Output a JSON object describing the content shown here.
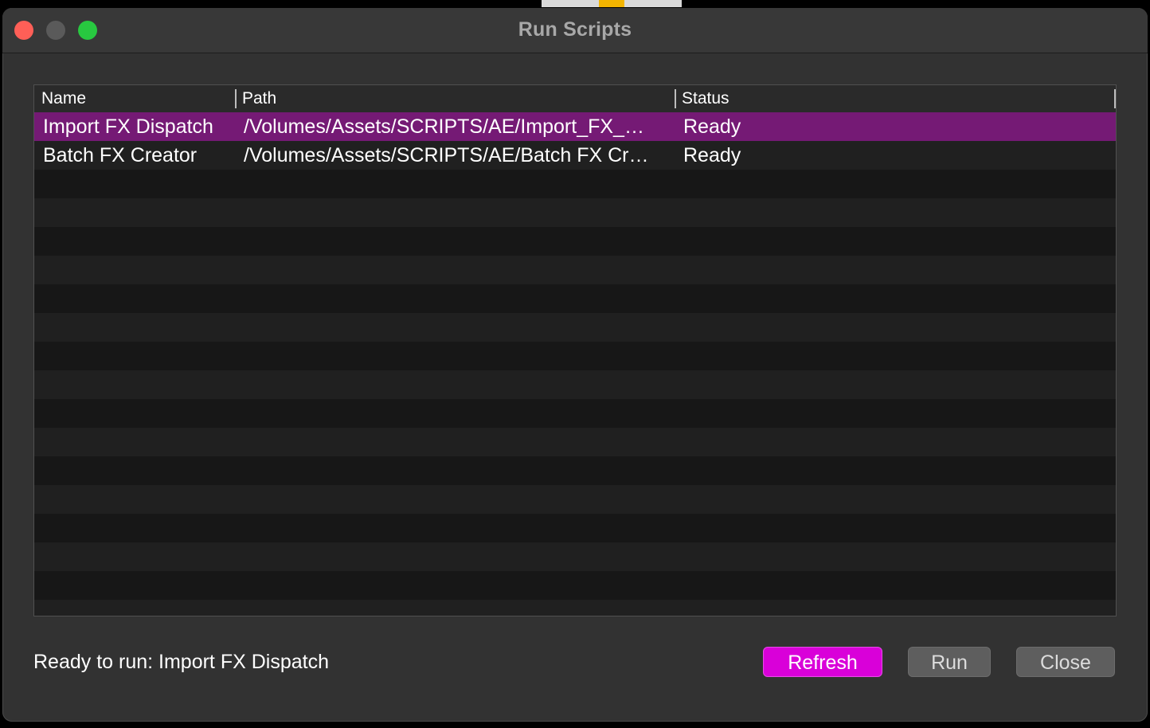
{
  "window": {
    "title": "Run Scripts"
  },
  "table": {
    "columns": [
      "Name",
      "Path",
      "Status"
    ],
    "rows": [
      {
        "name": "Import FX Dispatch",
        "path": "/Volumes/Assets/SCRIPTS/AE/Import_FX_…",
        "status": "Ready",
        "selected": true
      },
      {
        "name": "Batch FX Creator",
        "path": "/Volumes/Assets/SCRIPTS/AE/Batch FX Cr…",
        "status": "Ready",
        "selected": false
      }
    ]
  },
  "footer": {
    "status_text": "Ready to run: Import FX Dispatch",
    "refresh_label": "Refresh",
    "run_label": "Run",
    "close_label": "Close"
  },
  "colors": {
    "accent": "#d900d9",
    "selection": "#751a75",
    "close_light": "#ff5f57",
    "maximize_light": "#28c840"
  }
}
